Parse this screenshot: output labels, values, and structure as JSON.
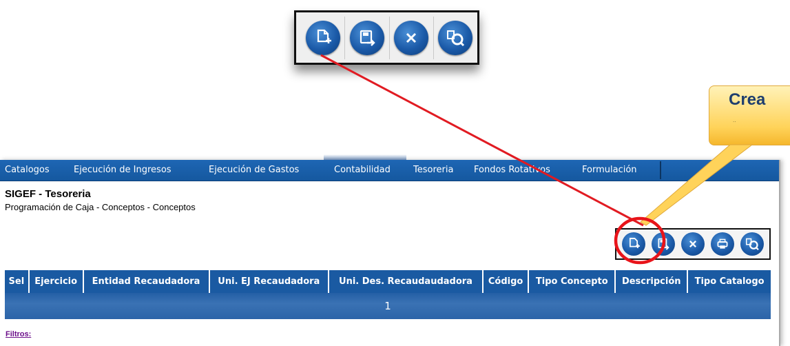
{
  "zoom_toolbar": {
    "buttons": [
      {
        "name": "new-document-icon"
      },
      {
        "name": "save-icon"
      },
      {
        "name": "close-icon"
      },
      {
        "name": "search-icon"
      }
    ]
  },
  "callout": {
    "text": "Crea",
    "subtext": "..",
    "color": "#ffd35a"
  },
  "menu": {
    "items": [
      "Catalogos",
      "Ejecución de Ingresos",
      "Ejecución de Gastos",
      "Contabilidad",
      "Tesoreria",
      "Fondos Rotativos",
      "Formulación"
    ]
  },
  "page": {
    "title": "SIGEF - Tesoreria",
    "breadcrumb": "Programación de Caja - Conceptos - Conceptos"
  },
  "toolbar": {
    "buttons": [
      {
        "name": "new-document-icon"
      },
      {
        "name": "save-icon"
      },
      {
        "name": "close-icon"
      },
      {
        "name": "print-icon"
      },
      {
        "name": "search-icon"
      }
    ]
  },
  "grid": {
    "columns": [
      "Sel",
      "Ejercicio",
      "Entidad Recaudadora",
      "Uni. EJ Recaudadora",
      "Uni. Des. Recaudaudadora",
      "Código",
      "Tipo Concepto",
      "Descripción",
      "Tipo Catalogo"
    ],
    "pager": "1"
  },
  "filters": {
    "label": "Filtros:"
  },
  "colors": {
    "menu_blue": "#1a5aa2",
    "highlight_red": "#e8141a",
    "arrow_red": "#e11b22",
    "callout_yellow": "#ffd35a"
  }
}
